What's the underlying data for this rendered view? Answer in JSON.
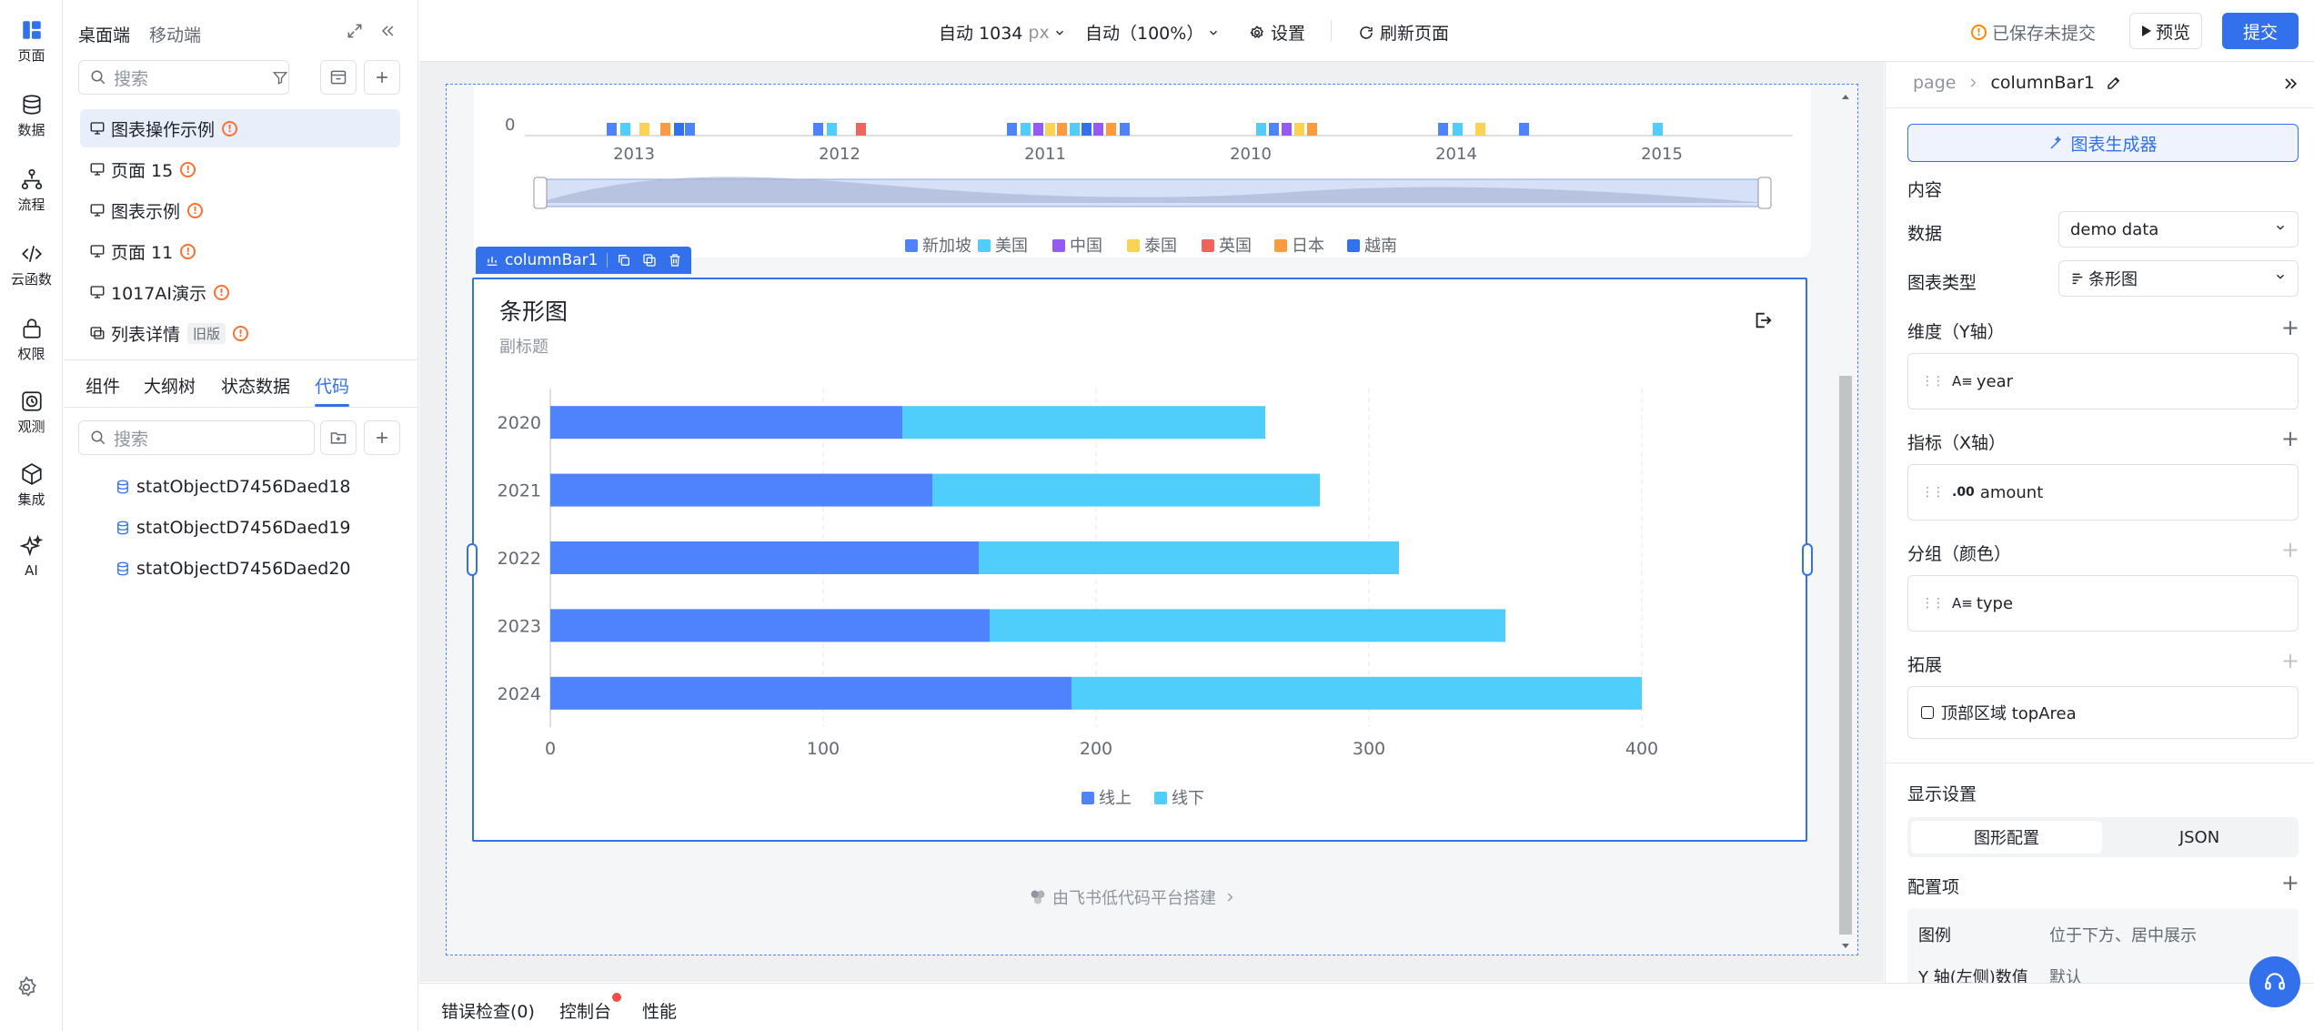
{
  "rail": {
    "items": [
      {
        "label": "页面",
        "icon": "layout-icon"
      },
      {
        "label": "数据",
        "icon": "database-icon"
      },
      {
        "label": "流程",
        "icon": "flow-icon"
      },
      {
        "label": "云函数",
        "icon": "code-icon"
      },
      {
        "label": "权限",
        "icon": "lock-icon"
      },
      {
        "label": "观测",
        "icon": "clock-icon"
      },
      {
        "label": "集成",
        "icon": "cube-icon"
      },
      {
        "label": "AI",
        "icon": "sparkle-icon"
      }
    ]
  },
  "left": {
    "tabs": [
      "桌面端",
      "移动端"
    ],
    "search_placeholder": "搜索",
    "pages": [
      {
        "label": "图表操作示例",
        "warn": true
      },
      {
        "label": "页面 15",
        "warn": true
      },
      {
        "label": "图表示例",
        "warn": true
      },
      {
        "label": "页面 11",
        "warn": true
      },
      {
        "label": "1017AI演示",
        "warn": true
      },
      {
        "label": "列表详情",
        "tag": "旧版",
        "warn": true
      }
    ],
    "bottom_tabs": [
      "组件",
      "大纲树",
      "状态数据",
      "代码"
    ],
    "code_search_placeholder": "搜索",
    "code_items": [
      "statObjectD7456Daed18",
      "statObjectD7456Daed19",
      "statObjectD7456Daed20"
    ]
  },
  "topbar": {
    "width_value": "自动 1034",
    "width_unit": "px",
    "zoom": "自动（100%）",
    "settings": "设置",
    "refresh": "刷新页面",
    "save_status": "已保存未提交",
    "preview": "预览",
    "submit": "提交"
  },
  "top_chart": {
    "x_zero": "0",
    "xticks": [
      "2013",
      "2012",
      "2011",
      "2010",
      "2014",
      "2015"
    ],
    "legend": [
      {
        "name": "新加坡",
        "color": "#4e83fd"
      },
      {
        "name": "美国",
        "color": "#50cefb"
      },
      {
        "name": "中国",
        "color": "#935af6"
      },
      {
        "name": "泰国",
        "color": "#fad355"
      },
      {
        "name": "英国",
        "color": "#f0645c"
      },
      {
        "name": "日本",
        "color": "#fa9c3e"
      },
      {
        "name": "越南",
        "color": "#3370eb"
      }
    ]
  },
  "component_tag": {
    "name": "columnBar1"
  },
  "chart_data": {
    "type": "bar",
    "orientation": "horizontal",
    "stacked": true,
    "title": "条形图",
    "subtitle": "副标题",
    "categories": [
      "2020",
      "2021",
      "2022",
      "2023",
      "2024"
    ],
    "series": [
      {
        "name": "线上",
        "color": "#4e83fd",
        "values": [
          129,
          140,
          157,
          161,
          191
        ]
      },
      {
        "name": "线下",
        "color": "#50cefb",
        "values": [
          133,
          142,
          154,
          189,
          209
        ]
      }
    ],
    "xlim": [
      0,
      400
    ],
    "xticks": [
      "0",
      "100",
      "200",
      "300",
      "400"
    ],
    "legend_position": "bottom-center",
    "grid": true
  },
  "footer_brand": "由飞书低代码平台搭建",
  "bottombar": {
    "tabs": [
      "错误检查(0)",
      "控制台",
      "性能"
    ]
  },
  "right": {
    "breadcrumb_root": "page",
    "breadcrumb_current": "columnBar1",
    "generator_button": "图表生成器",
    "section_content": "内容",
    "data_label": "数据",
    "data_value": "demo data",
    "chart_type_label": "图表类型",
    "chart_type_value": "条形图",
    "dimension_label": "维度（Y轴）",
    "dimension_field": "year",
    "metric_label": "指标（X轴）",
    "metric_field": "amount",
    "group_label": "分组（颜色）",
    "group_field": "type",
    "extend_label": "拓展",
    "extend_field": "顶部区域 topArea",
    "display_label": "显示设置",
    "seg_options": [
      "图形配置",
      "JSON"
    ],
    "config_label": "配置项",
    "legend_label": "图例",
    "legend_value": "位于下方、居中展示",
    "yaxis_label": "Y 轴(左侧)数值",
    "yaxis_value": "默认"
  }
}
